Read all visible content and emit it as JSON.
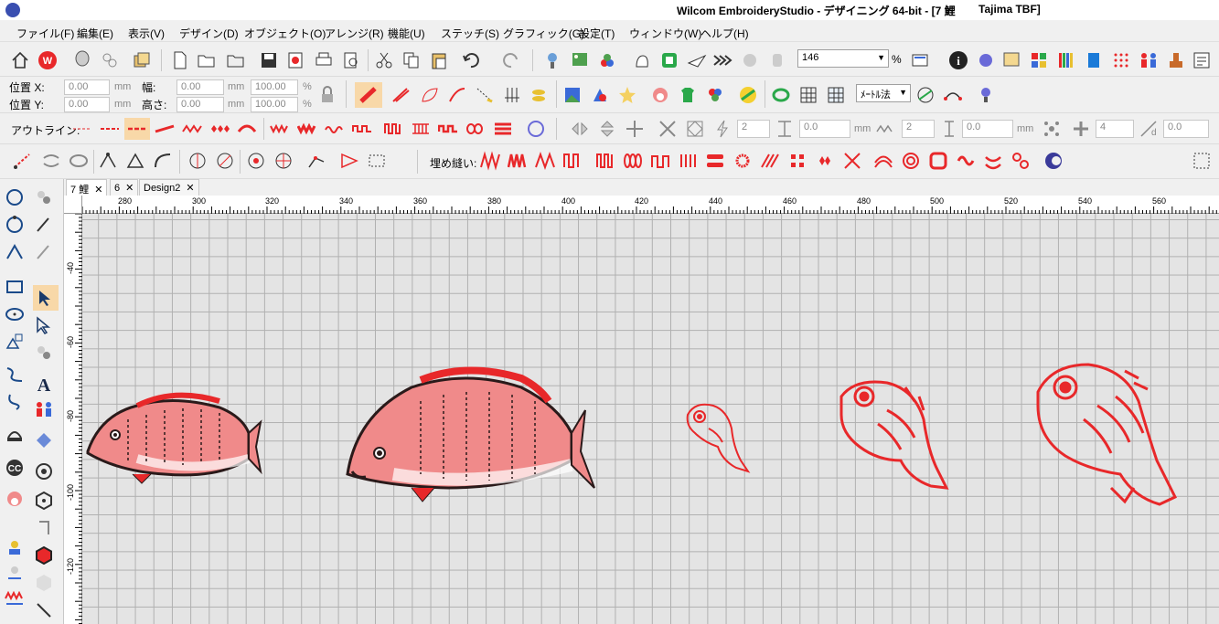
{
  "title": {
    "text": "Wilcom EmbroideryStudio - デザイニング 64-bit - [7 鯉",
    "machine": "Tajima TBF]"
  },
  "menu": [
    "ファイル(F)",
    "編集(E)",
    "表示(V)",
    "デザイン(D)",
    "オブジェクト(O)",
    "アレンジ(R)",
    "機能(U)",
    "ステッチ(S)",
    "グラフィック(G)",
    "設定(T)",
    "ウィンドウ(W)",
    "ヘルプ(H)"
  ],
  "toolbar1": {
    "zoom_value": "146",
    "zoom_unit": "%"
  },
  "position": {
    "x_label": "位置 X:",
    "x_value": "0.00",
    "x_unit": "mm",
    "y_label": "位置 Y:",
    "y_value": "0.00",
    "y_unit": "mm",
    "w_label": "幅:",
    "w_value": "0.00",
    "w_unit": "mm",
    "w_pct": "100.00",
    "w_pct_unit": "%",
    "h_label": "高さ:",
    "h_value": "0.00",
    "h_unit": "mm",
    "h_pct": "100.00",
    "h_pct_unit": "%"
  },
  "toolbar2": {
    "method_value": "ﾒｰﾄﾙ法"
  },
  "toolbar3": {
    "outline_label": "アウトライン:",
    "val1": "2",
    "val2": "0.0",
    "unit2": "mm",
    "val3": "2",
    "val4": "0.0",
    "unit4": "mm",
    "val5": "4",
    "val6": "0.0"
  },
  "toolbar4": {
    "fill_label": "埋め縫い:"
  },
  "tabs": [
    {
      "label": "7 鯉",
      "close": "✕"
    },
    {
      "label": "6",
      "close": "✕"
    },
    {
      "label": "Design2",
      "close": "✕"
    }
  ],
  "ruler_top": [
    "280",
    "300",
    "320",
    "340",
    "360",
    "380",
    "400",
    "420",
    "440",
    "460",
    "480",
    "500",
    "520",
    "540",
    "560"
  ],
  "ruler_left": [
    "-40",
    "-60",
    "-80",
    "-100",
    "-120"
  ],
  "colors": {
    "accent_red": "#e8282a",
    "fill_pink": "#f08a8a",
    "outline_dark": "#2a1a1a"
  },
  "designs": [
    {
      "name": "sea-bream-small-filled"
    },
    {
      "name": "sea-bream-large-filled"
    },
    {
      "name": "cartoon-fish-tiny-outline"
    },
    {
      "name": "cartoon-fish-medium-outline"
    },
    {
      "name": "cartoon-fish-large-outline"
    }
  ]
}
